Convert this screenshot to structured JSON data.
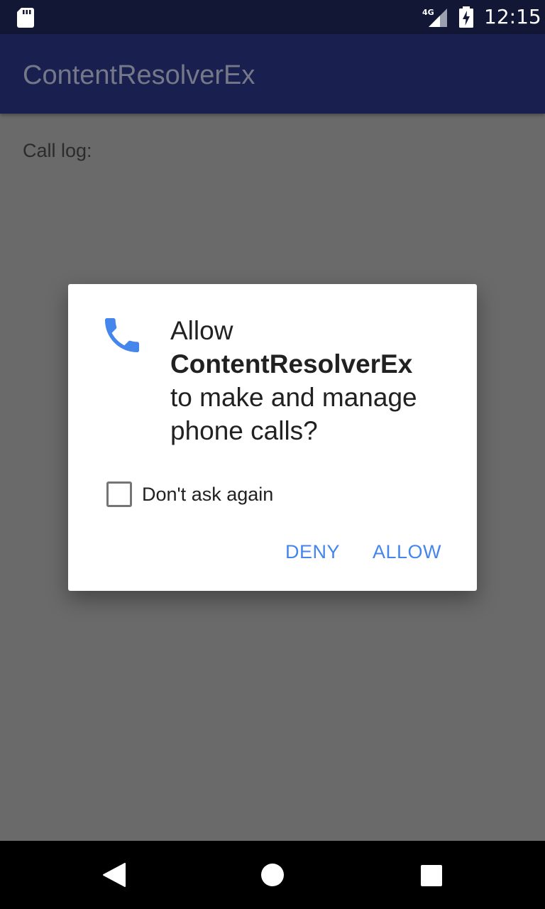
{
  "status_bar": {
    "time": "12:15",
    "network_label": "4G",
    "icons": [
      "sd-card-icon",
      "signal-icon",
      "battery-charging-icon"
    ]
  },
  "app_bar": {
    "title": "ContentResolverEx"
  },
  "content": {
    "label": "Call log:"
  },
  "dialog": {
    "icon": "phone-icon",
    "prefix": "Allow",
    "app_name": "ContentResolverEx",
    "suffix": "to make and manage phone calls?",
    "checkbox_label": "Don't ask again",
    "checkbox_checked": false,
    "deny_label": "DENY",
    "allow_label": "ALLOW"
  },
  "nav_bar": {
    "icons": [
      "back-icon",
      "home-icon",
      "recents-icon"
    ]
  },
  "colors": {
    "status_bar": "#131736",
    "app_bar": "#192050",
    "scrim_background": "#6a6a6a",
    "accent": "#4586ec"
  }
}
